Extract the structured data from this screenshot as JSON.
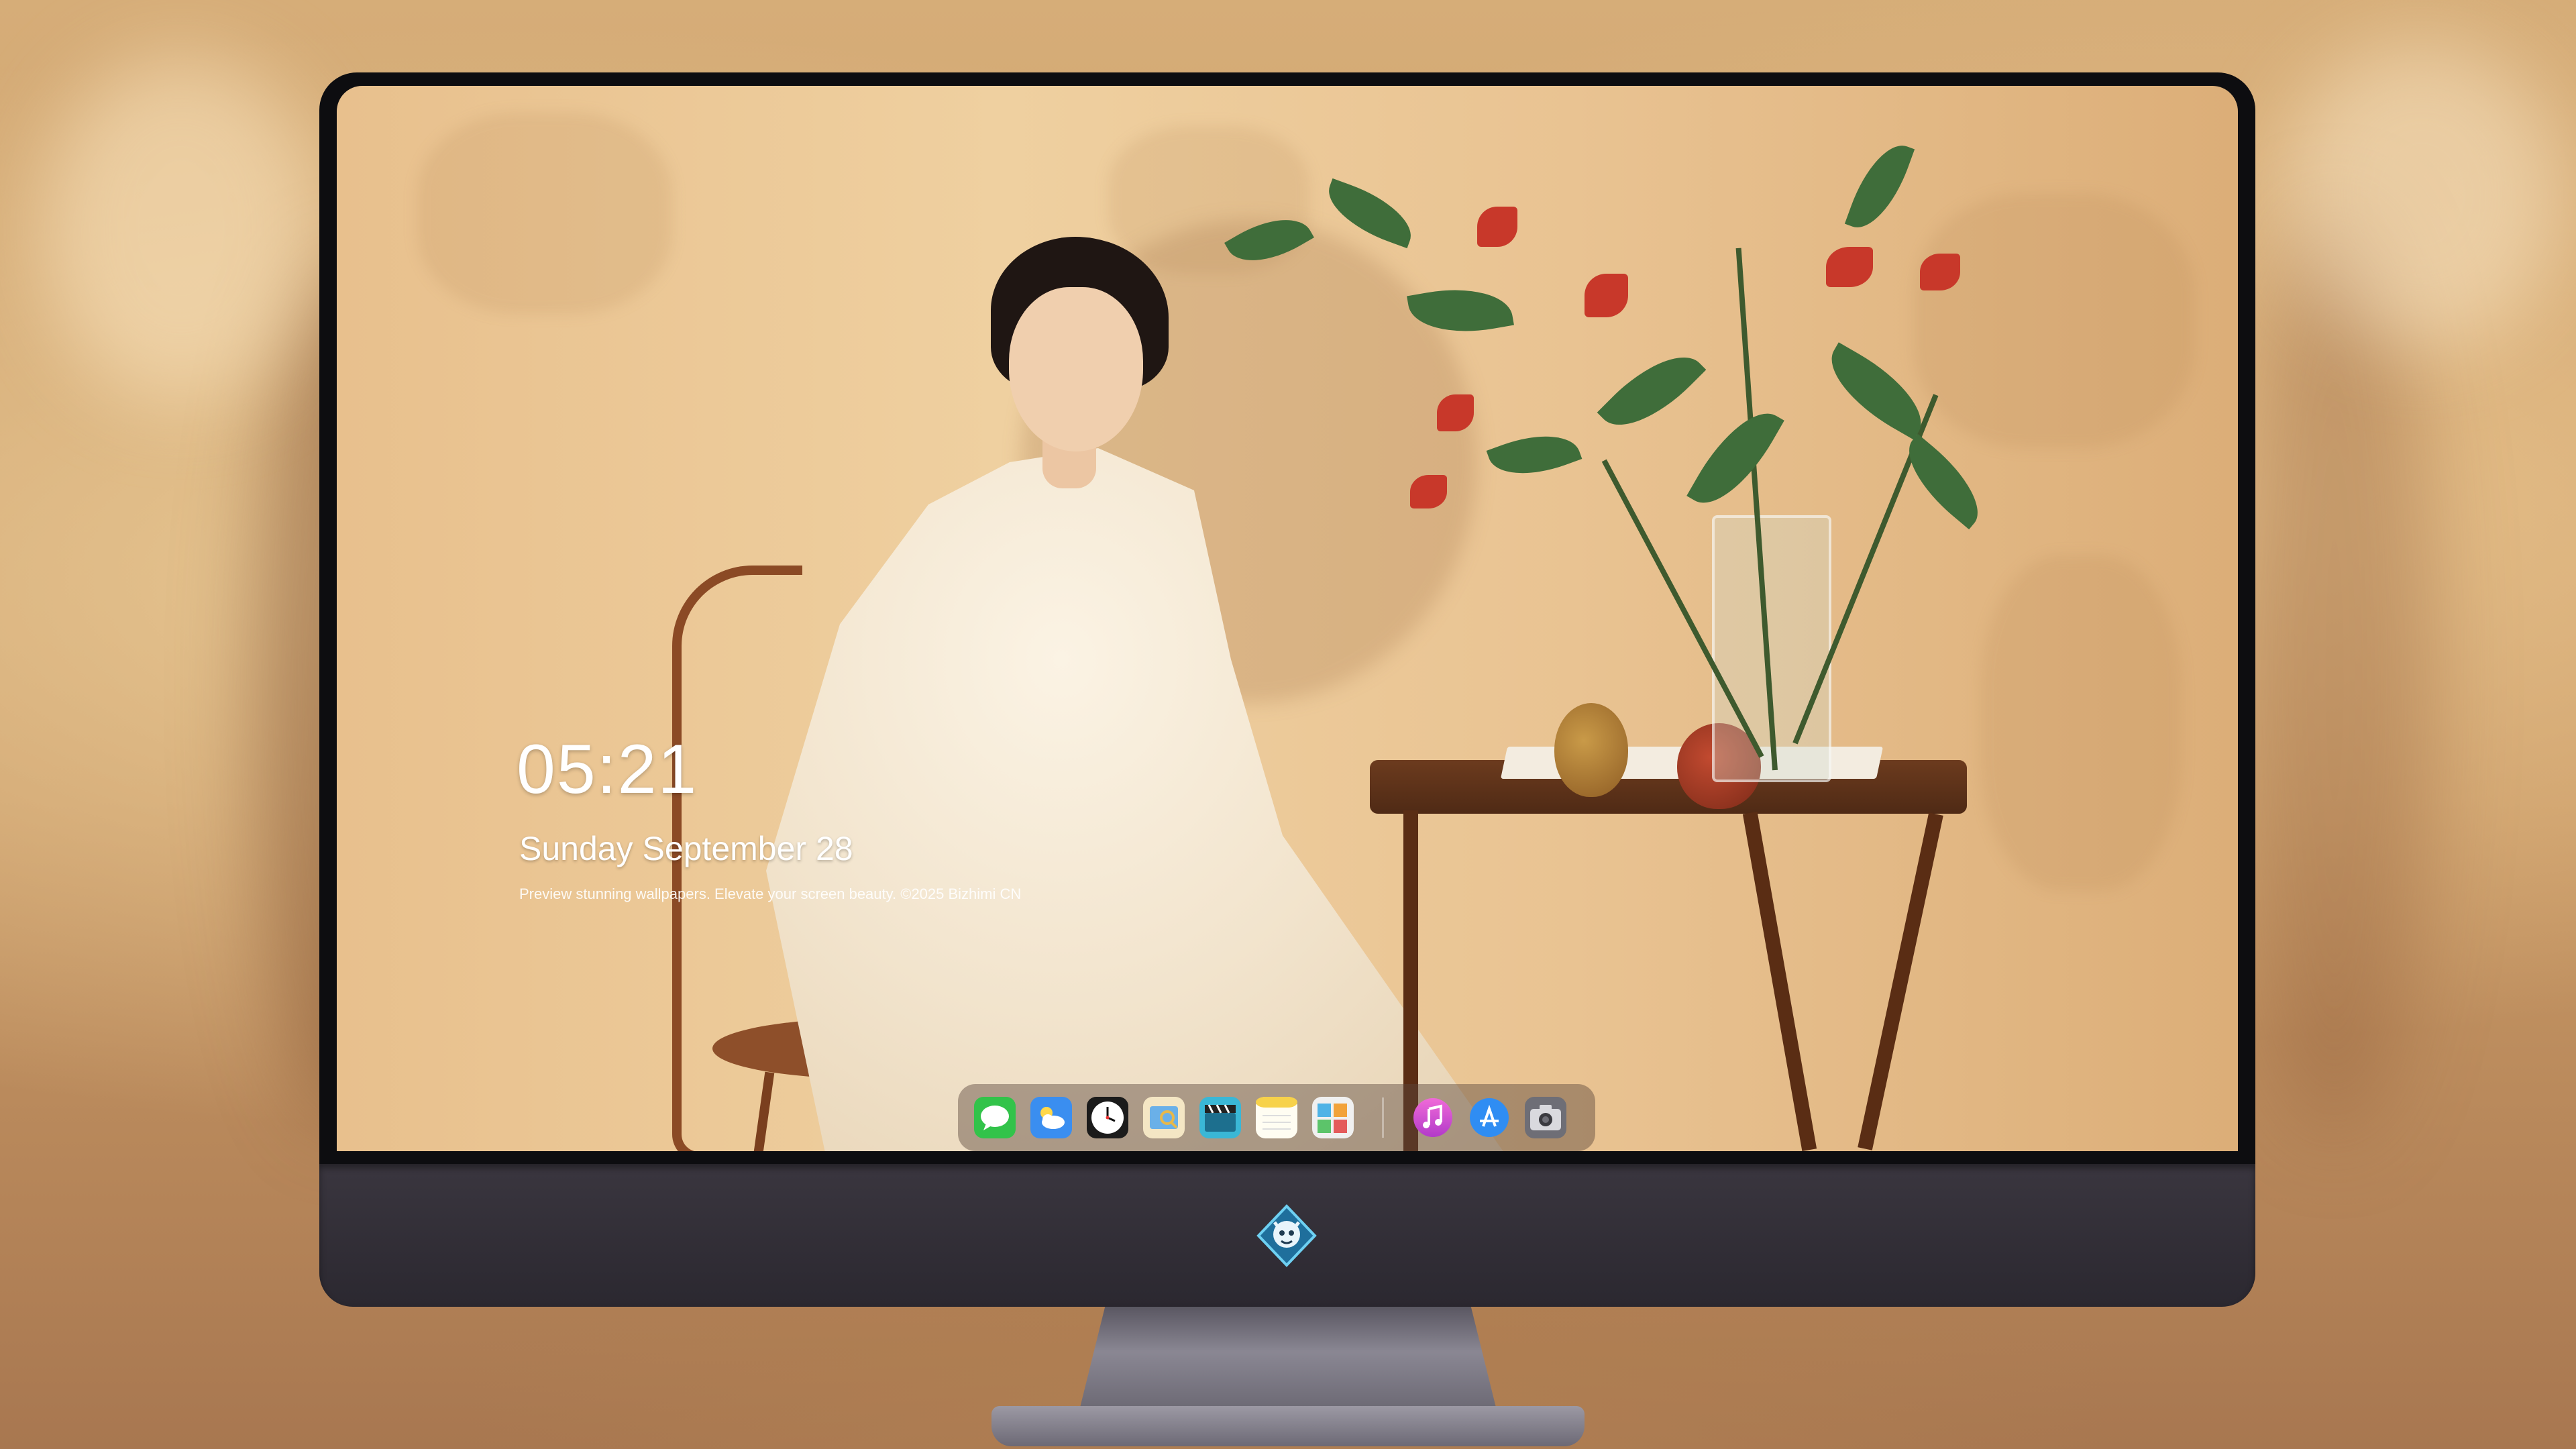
{
  "lock_screen": {
    "time": "05:21",
    "date": "Sunday September  28",
    "tagline": "Preview stunning wallpapers. Elevate your screen beauty. ©2025 Bizhimi CN"
  },
  "dock": {
    "apps": [
      {
        "name": "messages",
        "icon": "message-bubble-icon",
        "color": "#32c34a"
      },
      {
        "name": "weather",
        "icon": "cloud-sun-icon",
        "color": "#3a8ef0"
      },
      {
        "name": "clock",
        "icon": "clock-icon",
        "color": "#ffffff"
      },
      {
        "name": "preview",
        "icon": "preview-icon",
        "color": "#e7b84a"
      },
      {
        "name": "final-cut",
        "icon": "clapperboard-icon",
        "color": "#3ab7d6"
      },
      {
        "name": "notes",
        "icon": "notes-icon",
        "color": "#f7e38a"
      },
      {
        "name": "photo-booth",
        "icon": "photos-icon",
        "color": "#4fb3e6"
      },
      {
        "name": "music",
        "icon": "music-note-icon",
        "color": "#e14bd5"
      },
      {
        "name": "app-store",
        "icon": "app-store-icon",
        "color": "#2f8df3"
      },
      {
        "name": "camera",
        "icon": "camera-icon",
        "color": "#777780"
      }
    ]
  },
  "colors": {
    "monitor_bezel": "#0d0d10",
    "monitor_chin": "#2e2b33",
    "clock_text": "#ffffff"
  }
}
